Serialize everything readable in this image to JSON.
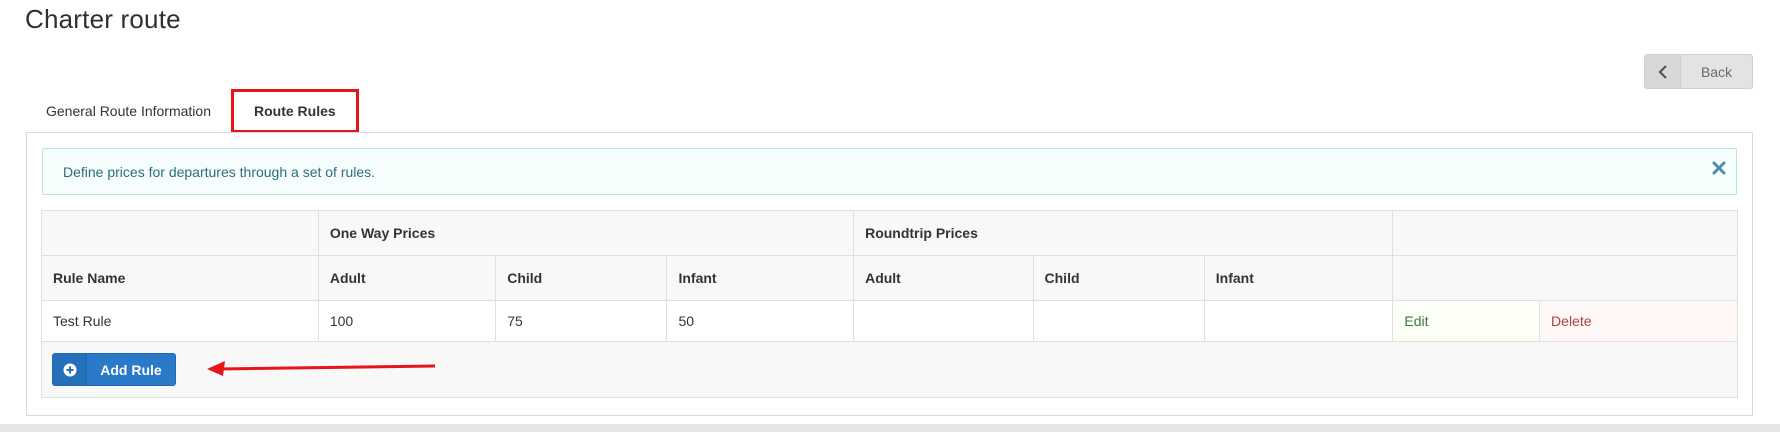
{
  "page": {
    "title": "Charter route"
  },
  "back_button": {
    "label": "Back",
    "icon": "chevron-left-icon"
  },
  "tabs": [
    {
      "label": "General Route Information",
      "active": false
    },
    {
      "label": "Route Rules",
      "active": true
    }
  ],
  "alert": {
    "message": "Define prices for departures through a set of rules.",
    "close_icon": "close-icon"
  },
  "table": {
    "group_headers": {
      "one_way": "One Way Prices",
      "roundtrip": "Roundtrip Prices"
    },
    "column_headers": {
      "rule_name": "Rule Name",
      "ow_adult": "Adult",
      "ow_child": "Child",
      "ow_infant": "Infant",
      "rt_adult": "Adult",
      "rt_child": "Child",
      "rt_infant": "Infant"
    },
    "rows": [
      {
        "rule_name": "Test Rule",
        "ow_adult": "100",
        "ow_child": "75",
        "ow_infant": "50",
        "rt_adult": "",
        "rt_child": "",
        "rt_infant": "",
        "edit_label": "Edit",
        "delete_label": "Delete"
      }
    ]
  },
  "add_rule_button": {
    "label": "Add Rule",
    "icon": "plus-circle-icon"
  },
  "colors": {
    "annotation_red": "#e8141c",
    "primary_blue": "#2a7ac9",
    "info_text": "#2d6d7c",
    "edit_green": "#3c763d",
    "delete_red": "#a94442"
  }
}
